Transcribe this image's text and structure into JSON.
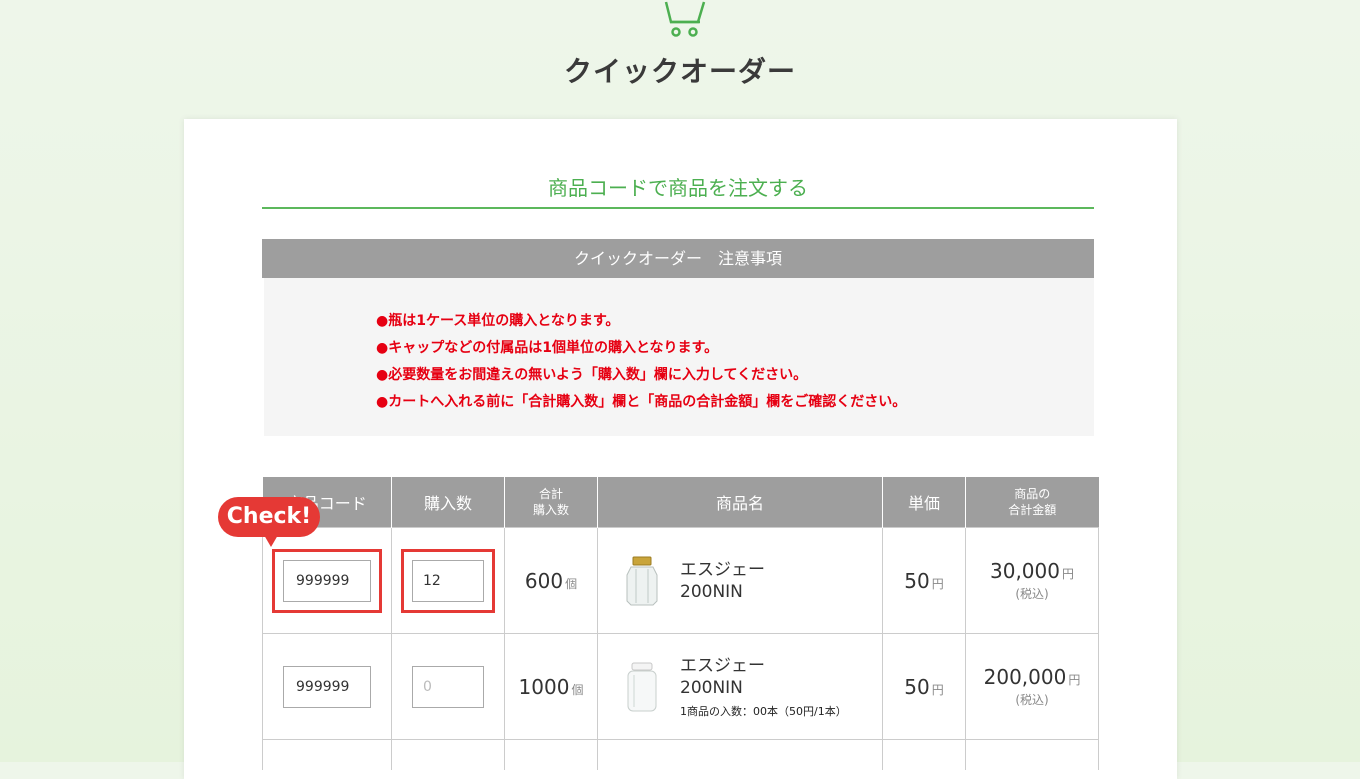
{
  "page": {
    "title": "クイックオーダー"
  },
  "section": {
    "title": "商品コードで商品を注文する"
  },
  "notice": {
    "header": "クイックオーダー　注意事項",
    "items": [
      "●瓶は1ケース単位の購入となります。",
      "●キャップなどの付属品は1個単位の購入となります。",
      "●必要数量をお間違えの無いよう「購入数」欄に入力してください。",
      "●カートへ入れる前に「合計購入数」欄と「商品の合計金額」欄をご確認ください。"
    ]
  },
  "table": {
    "headers": {
      "code": "商品コード",
      "qty": "購入数",
      "total_qty_line1": "合計",
      "total_qty_line2": "購入数",
      "name": "商品名",
      "price": "単価",
      "total_price_line1": "商品の",
      "total_price_line2": "合計金額"
    },
    "rows": [
      {
        "code": "999999",
        "qty": "12",
        "total_qty": "600",
        "total_qty_unit": "個",
        "name_line1": "エスジェー",
        "name_line2": "200NIN",
        "price": "50",
        "price_unit": "円",
        "total_price": "30,000",
        "total_price_unit": "円",
        "tax": "(税込)"
      },
      {
        "code": "999999",
        "qty_placeholder": "0",
        "total_qty": "1000",
        "total_qty_unit": "個",
        "name_line1": "エスジェー",
        "name_line2": "200NIN",
        "note": "1商品の入数：00本（50円/1本）",
        "price": "50",
        "price_unit": "円",
        "total_price": "200,000",
        "total_price_unit": "円",
        "tax": "(税込)"
      }
    ]
  },
  "callout": {
    "label": "Check!"
  },
  "colors": {
    "accent_green": "#4caf50",
    "alert_red": "#e60012",
    "highlight_red": "#e53935",
    "header_gray": "#9e9e9e"
  },
  "icons": {
    "cart": "cart-icon",
    "jar": "jar-icon"
  }
}
